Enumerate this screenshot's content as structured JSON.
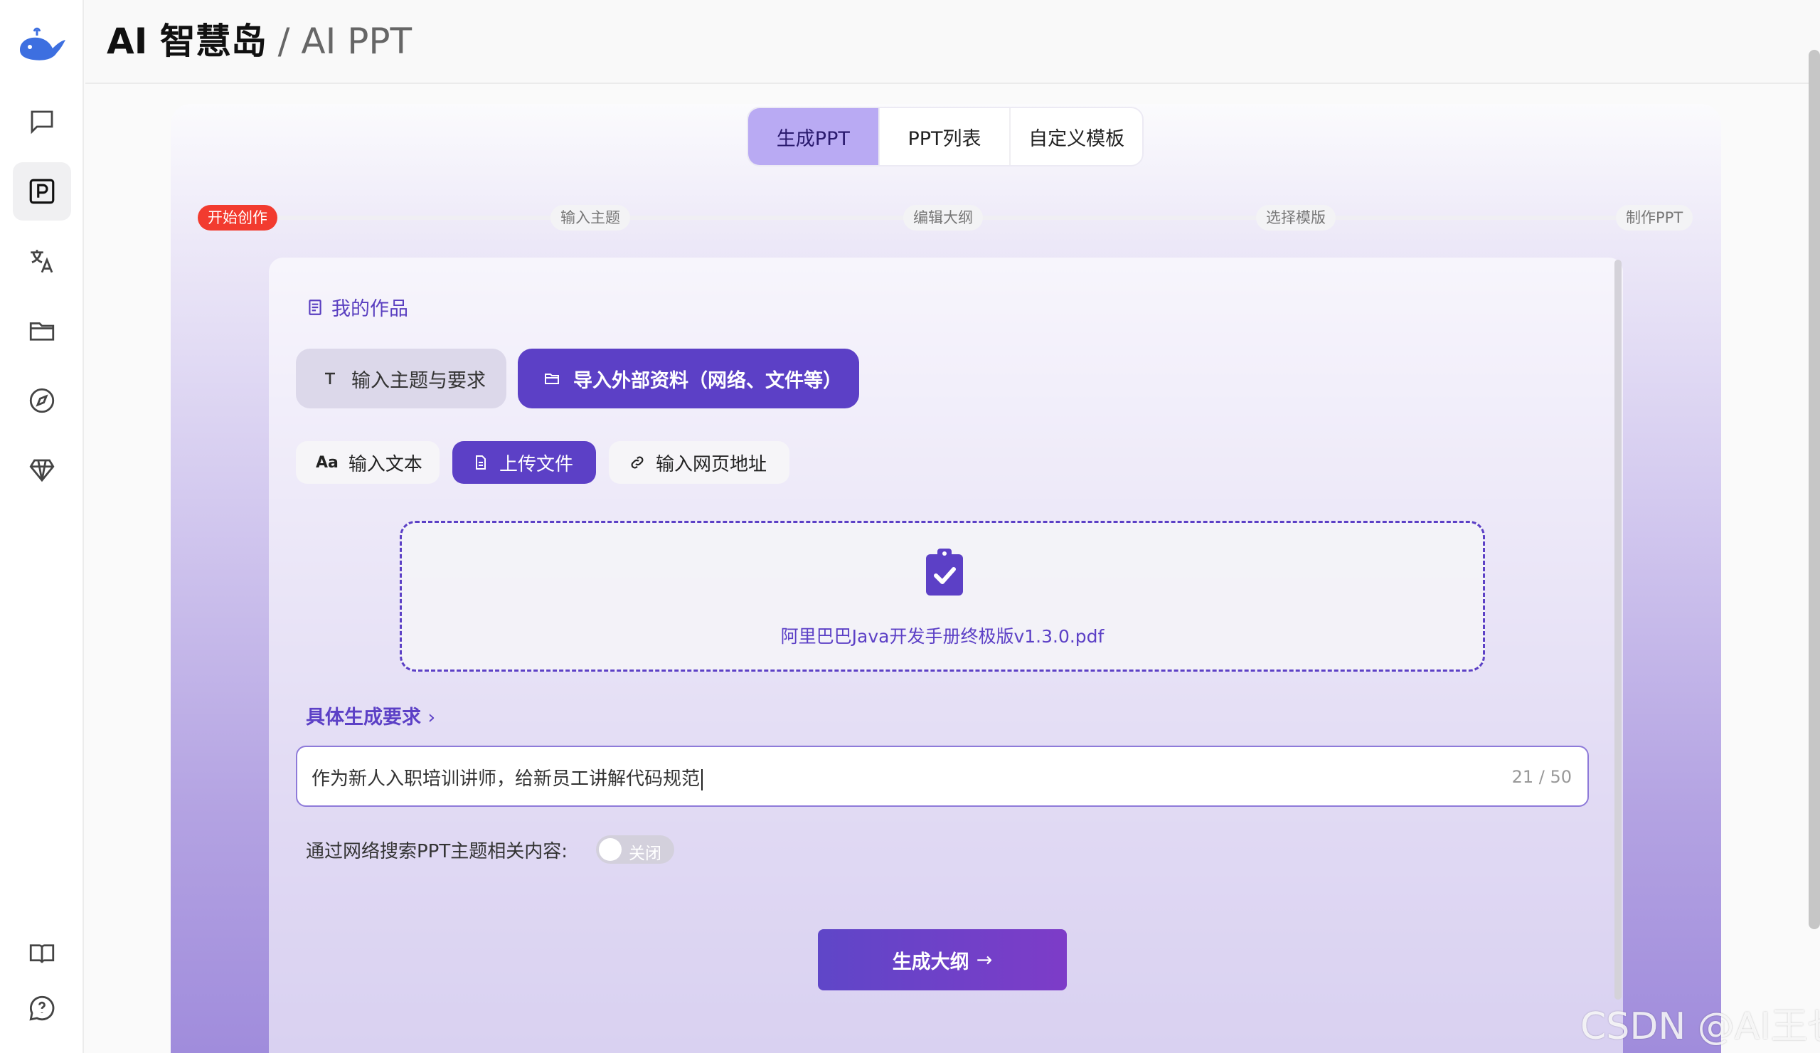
{
  "header": {
    "brand": "AI 智慧岛",
    "separator": " / ",
    "section": "AI PPT"
  },
  "sidebar": {
    "items": [
      {
        "name": "chat",
        "icon": "chat-bubble-icon"
      },
      {
        "name": "ppt",
        "icon": "ppt-icon",
        "active": true
      },
      {
        "name": "translate",
        "icon": "translate-icon"
      },
      {
        "name": "files",
        "icon": "folder-icon"
      },
      {
        "name": "explore",
        "icon": "compass-icon"
      },
      {
        "name": "premium",
        "icon": "diamond-icon"
      }
    ],
    "bottom": [
      {
        "name": "docs",
        "icon": "book-icon"
      },
      {
        "name": "help",
        "icon": "help-chat-icon"
      }
    ]
  },
  "tabs": [
    "生成PPT",
    "PPT列表",
    "自定义模板"
  ],
  "steps": [
    "开始创作",
    "输入主题",
    "编辑大纲",
    "选择模版",
    "制作PPT"
  ],
  "my_works": "我的作品",
  "modes": {
    "text": "输入主题与要求",
    "import": "导入外部资料（网络、文件等）"
  },
  "sources": {
    "text": "输入文本",
    "upload": "上传文件",
    "url": "输入网页地址",
    "aa": "Aa"
  },
  "upload": {
    "file_name": "阿里巴巴Java开发手册终极版v1.3.0.pdf"
  },
  "requirement": {
    "label": "具体生成要求",
    "value": "作为新人入职培训讲师，给新员工讲解代码规范",
    "count": "21 / 50"
  },
  "search": {
    "label": "通过网络搜索PPT主题相关内容:",
    "toggle": "关闭"
  },
  "generate_button": "生成大纲",
  "watermark": "CSDN @AI王也",
  "colors": {
    "accent": "#5c40c6",
    "active_tab": "#b9aaf3",
    "step_active": "#f23b2f"
  }
}
